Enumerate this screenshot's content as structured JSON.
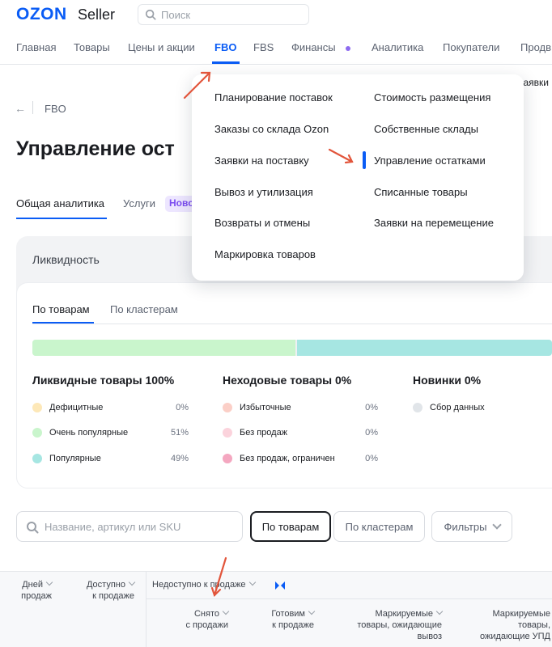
{
  "header": {
    "logo": "OZON",
    "logo_sub": "Seller",
    "search_placeholder": "Поиск"
  },
  "nav": {
    "items": [
      "Главная",
      "Товары",
      "Цены и акции",
      "FBO",
      "FBS",
      "Финансы",
      "Аналитика",
      "Покупатели",
      "Продв"
    ],
    "active": "FBO"
  },
  "breadcrumb": {
    "back": "←",
    "current": "FBO"
  },
  "page": {
    "title": "Управление ост",
    "peek_text": "заявки н"
  },
  "tabs": {
    "items": [
      "Общая аналитика",
      "Услуги"
    ],
    "badge": "Ново"
  },
  "dropdown": {
    "left": [
      "Планирование поставок",
      "Заказы со склада Ozon",
      "Заявки на поставку",
      "Вывоз и утилизация",
      "Возвраты и отмены",
      "Маркировка товаров"
    ],
    "right": [
      "Стоимость размещения",
      "Собственные склады",
      "Управление остатками",
      "Списанные товары",
      "Заявки на перемещение"
    ],
    "active": "Управление остатками"
  },
  "liquidity": {
    "title": "Ликвидность",
    "subtabs": [
      "По товарам",
      "По кластерам"
    ],
    "bar": [
      {
        "share": 51,
        "color": "#c9f5cc"
      },
      {
        "share": 49,
        "color": "#a6e6e2"
      }
    ],
    "groups": [
      {
        "title": "Ликвидные товары 100%",
        "items": [
          {
            "label": "Дефицитные",
            "value": "0%",
            "color": "#fde8b8"
          },
          {
            "label": "Очень популярные",
            "value": "51%",
            "color": "#c9f5cc"
          },
          {
            "label": "Популярные",
            "value": "49%",
            "color": "#a6e6e2"
          }
        ]
      },
      {
        "title": "Неходовые товары 0%",
        "items": [
          {
            "label": "Избыточные",
            "value": "0%",
            "color": "#fbcfc7"
          },
          {
            "label": "Без продаж",
            "value": "0%",
            "color": "#fbd3dc"
          },
          {
            "label": "Без продаж, ограничен",
            "value": "0%",
            "color": "#f4a7c0"
          }
        ]
      },
      {
        "title": "Новинки 0%",
        "items": [
          {
            "label": "Сбор данных",
            "value": "",
            "color": "#e1e5e9"
          }
        ]
      }
    ]
  },
  "filters": {
    "search_placeholder": "Название, артикул или SKU",
    "by_products": "По товарам",
    "by_clusters": "По кластерам",
    "filters": "Фильтры"
  },
  "table": {
    "col_days_1": "Дней",
    "col_days_2": "продаж",
    "col_avail_1": "Доступно",
    "col_avail_2": "к продаже",
    "col_unavail": "Недоступно к продаже",
    "sub_removed_1": "Снято",
    "sub_removed_2": "с продажи",
    "sub_preparing_1": "Готовим",
    "sub_preparing_2": "к продаже",
    "sub_marked_1": "Маркируемые",
    "sub_marked_2": "товары, ожидающие",
    "sub_marked_3": "вывоз",
    "sub_marked_upd_1": "Маркируемые",
    "sub_marked_upd_2": "товары,",
    "sub_marked_upd_3": "ожидающие УПД"
  }
}
